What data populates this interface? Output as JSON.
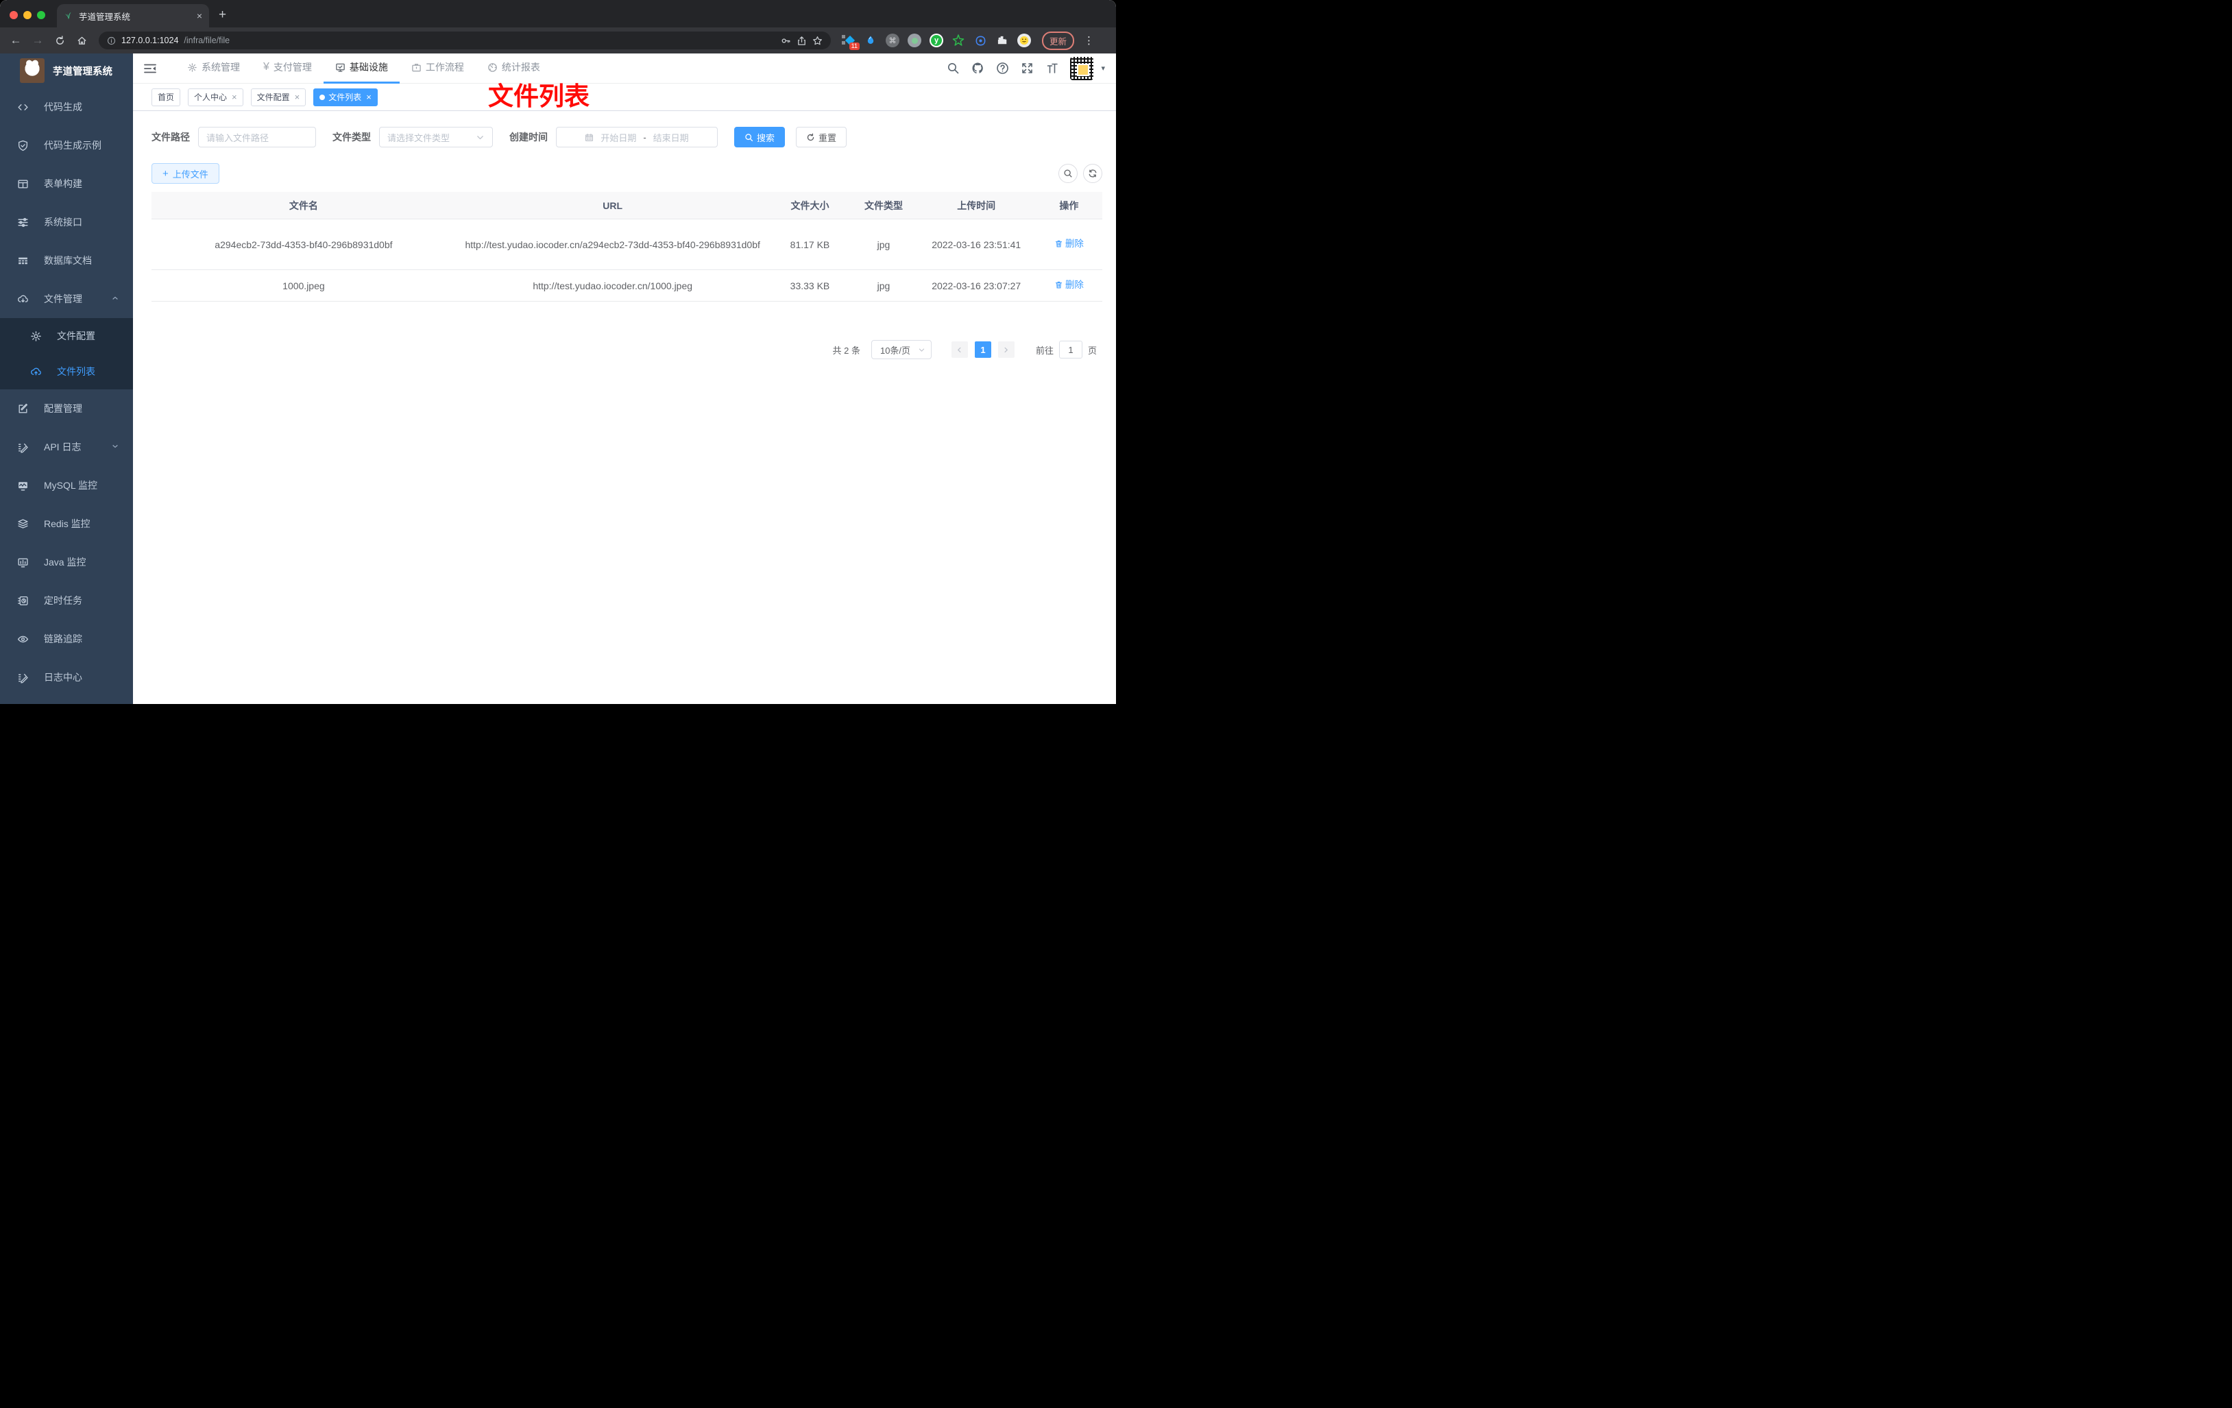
{
  "browser": {
    "tab_title": "芋道管理系统",
    "new_tab_plus": "+",
    "url_host": "127.0.0.1:1024",
    "url_path": "/infra/file/file",
    "extension_badge": "11",
    "update_button": "更新"
  },
  "header": {
    "logo_title": "芋道管理系统",
    "menu": [
      {
        "label": "系统管理",
        "active": false
      },
      {
        "label": "支付管理",
        "active": false
      },
      {
        "label": "基础设施",
        "active": true
      },
      {
        "label": "工作流程",
        "active": false
      },
      {
        "label": "统计报表",
        "active": false
      }
    ]
  },
  "sidebar": {
    "items": [
      {
        "label": "代码生成"
      },
      {
        "label": "代码生成示例"
      },
      {
        "label": "表单构建"
      },
      {
        "label": "系统接口"
      },
      {
        "label": "数据库文档"
      },
      {
        "label": "文件管理",
        "expanded": true
      },
      {
        "label": "文件配置",
        "sub": true
      },
      {
        "label": "文件列表",
        "sub": true,
        "active": true
      },
      {
        "label": "配置管理"
      },
      {
        "label": "API 日志",
        "collapsed": true
      },
      {
        "label": "MySQL 监控"
      },
      {
        "label": "Redis 监控"
      },
      {
        "label": "Java 监控"
      },
      {
        "label": "定时任务"
      },
      {
        "label": "链路追踪"
      },
      {
        "label": "日志中心"
      }
    ]
  },
  "tags": [
    {
      "label": "首页",
      "closable": false,
      "active": false
    },
    {
      "label": "个人中心",
      "closable": true,
      "active": false
    },
    {
      "label": "文件配置",
      "closable": true,
      "active": false
    },
    {
      "label": "文件列表",
      "closable": true,
      "active": true
    }
  ],
  "annotation": {
    "text": "文件列表",
    "color": "#ff0b07"
  },
  "filters": {
    "path_label": "文件路径",
    "path_placeholder": "请输入文件路径",
    "type_label": "文件类型",
    "type_placeholder": "请选择文件类型",
    "date_label": "创建时间",
    "date_start_placeholder": "开始日期",
    "date_separator": "-",
    "date_end_placeholder": "结束日期",
    "search_button": "搜索",
    "reset_button": "重置"
  },
  "toolbar": {
    "upload_button": "上传文件"
  },
  "table": {
    "columns": [
      "文件名",
      "URL",
      "文件大小",
      "文件类型",
      "上传时间",
      "操作"
    ],
    "rows": [
      {
        "name": "a294ecb2-73dd-4353-bf40-296b8931d0bf",
        "url": "http://test.yudao.iocoder.cn/a294ecb2-73dd-4353-bf40-296b8931d0bf",
        "size": "81.17 KB",
        "type": "jpg",
        "time": "2022-03-16 23:51:41",
        "action": "删除"
      },
      {
        "name": "1000.jpeg",
        "url": "http://test.yudao.iocoder.cn/1000.jpeg",
        "size": "33.33 KB",
        "type": "jpg",
        "time": "2022-03-16 23:07:27",
        "action": "删除"
      }
    ]
  },
  "pagination": {
    "total": "共 2 条",
    "page_size": "10条/页",
    "current_page": "1",
    "goto_label": "前往",
    "goto_value": "1",
    "page_unit": "页"
  },
  "colors": {
    "accent": "#409eff",
    "sidebar_bg": "#304156",
    "submenu_bg": "#1f2d3d",
    "annotation_red": "#ff0b07",
    "table_header_bg": "#f8f8f9"
  }
}
